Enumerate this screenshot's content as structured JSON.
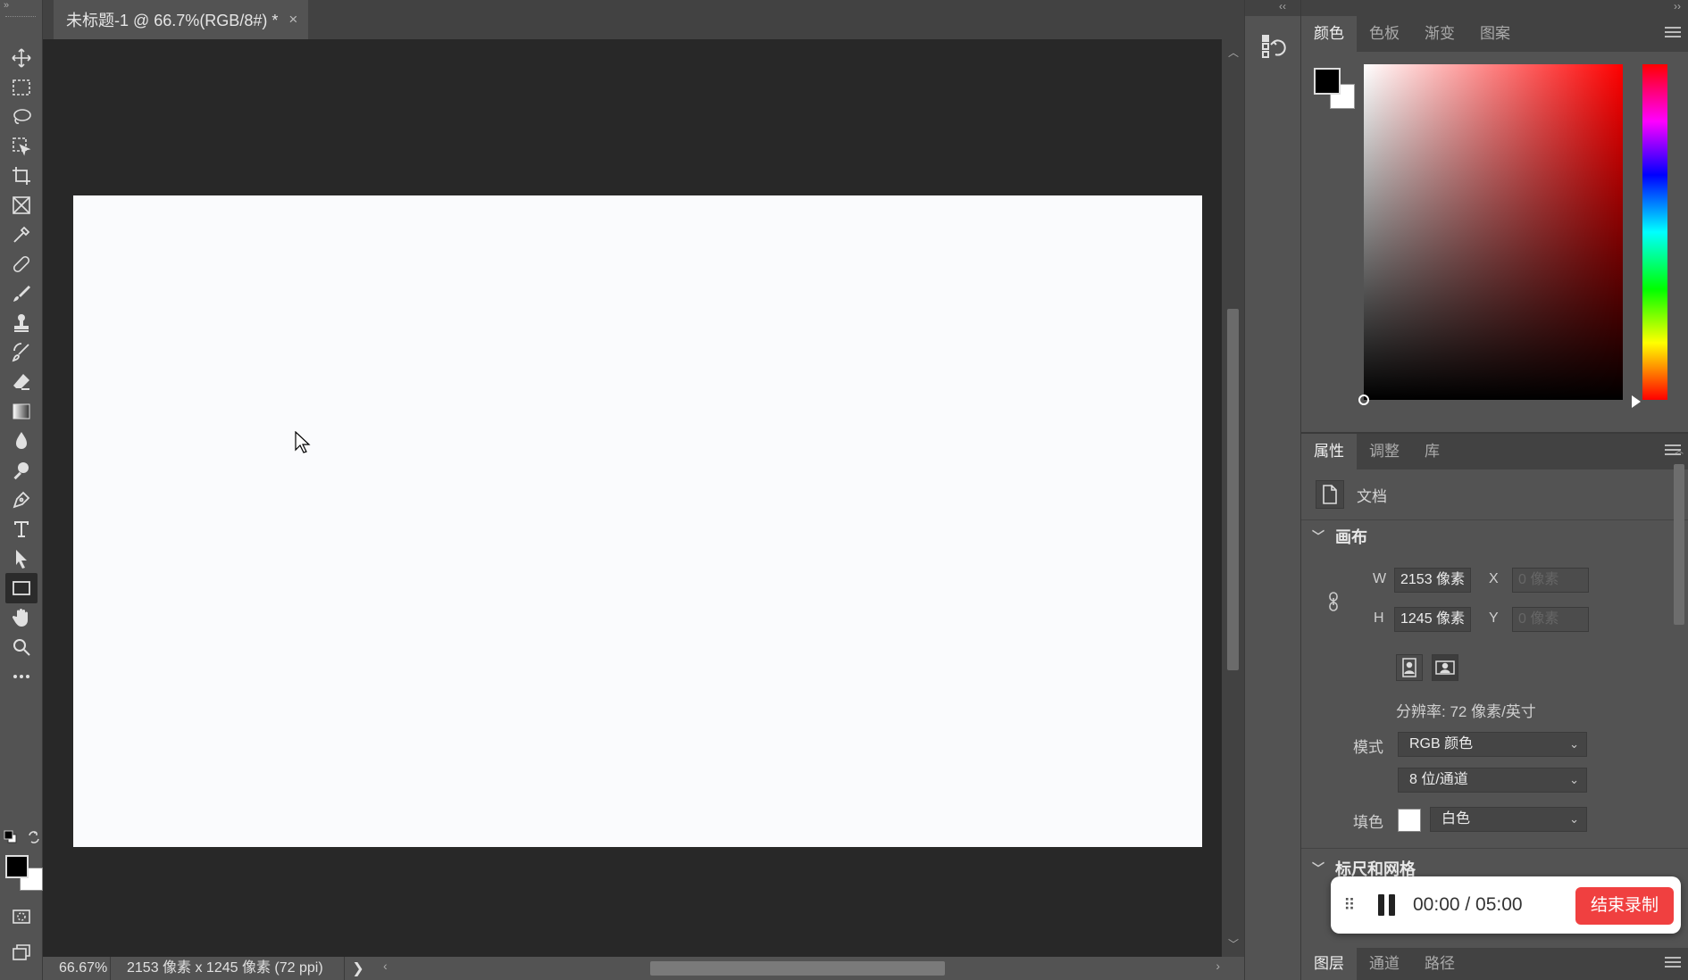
{
  "document": {
    "tab_title": "未标题-1 @ 66.7%(RGB/8#) *",
    "close_glyph": "×"
  },
  "status": {
    "zoom": "66.67%",
    "doc_info": "2153 像素 x 1245 像素 (72 ppi)",
    "arrow": "❯"
  },
  "color_panel": {
    "tabs": [
      "颜色",
      "色板",
      "渐变",
      "图案"
    ],
    "active_tab": 0,
    "foreground": "#000000",
    "background": "#ffffff"
  },
  "properties_panel": {
    "tabs": [
      "属性",
      "调整",
      "库"
    ],
    "active_tab": 0,
    "doc_label": "文档",
    "canvas_section": "画布",
    "w_label": "W",
    "h_label": "H",
    "x_label": "X",
    "y_label": "Y",
    "width": "2153 像素",
    "height": "1245 像素",
    "x": "0 像素",
    "y": "0 像素",
    "resolution": "分辨率: 72 像素/英寸",
    "mode_label": "模式",
    "mode_value": "RGB 颜色",
    "depth_value": "8 位/通道",
    "fill_label": "填色",
    "fill_value": "白色",
    "rulers_section": "标尺和网格"
  },
  "layers_panel": {
    "tabs": [
      "图层",
      "通道",
      "路径"
    ],
    "active_tab": 0
  },
  "recording": {
    "time": "00:00 / 05:00",
    "stop_label": "结束录制"
  },
  "toolbar": {
    "active_tool": "rectangle-tool"
  }
}
